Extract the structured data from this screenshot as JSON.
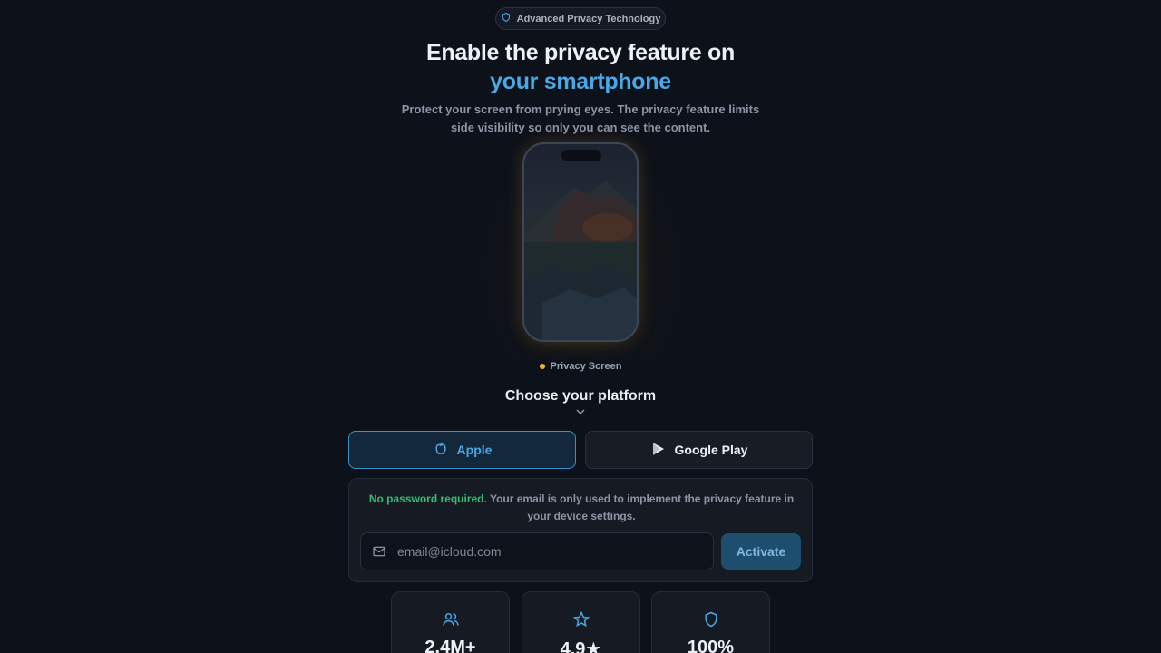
{
  "badge": {
    "label": "Advanced Privacy Technology",
    "icon": "shield-icon"
  },
  "hero": {
    "title_line1": "Enable the privacy feature on",
    "title_line2": "your smartphone",
    "subtitle": "Protect your screen from prying eyes. The privacy feature limits side visibility so only you can see the content."
  },
  "phone": {
    "status_label": "Privacy Screen",
    "status_color": "#f0b02c"
  },
  "platform": {
    "heading": "Choose your platform",
    "apple_label": "Apple",
    "google_label": "Google Play",
    "selected": "Apple"
  },
  "form": {
    "notice_strong": "No password required.",
    "notice_text": " Your email is only used to implement the privacy feature in your device settings.",
    "email_placeholder": "email@icloud.com",
    "submit_label": "Activate"
  },
  "stats": [
    {
      "icon": "users-icon",
      "value": "2.4M+"
    },
    {
      "icon": "star-icon",
      "value": "4.9★"
    },
    {
      "icon": "shield-icon",
      "value": "100%"
    }
  ],
  "colors": {
    "accent": "#4aa8e6",
    "success": "#2fbf71",
    "background": "#0d1119"
  }
}
